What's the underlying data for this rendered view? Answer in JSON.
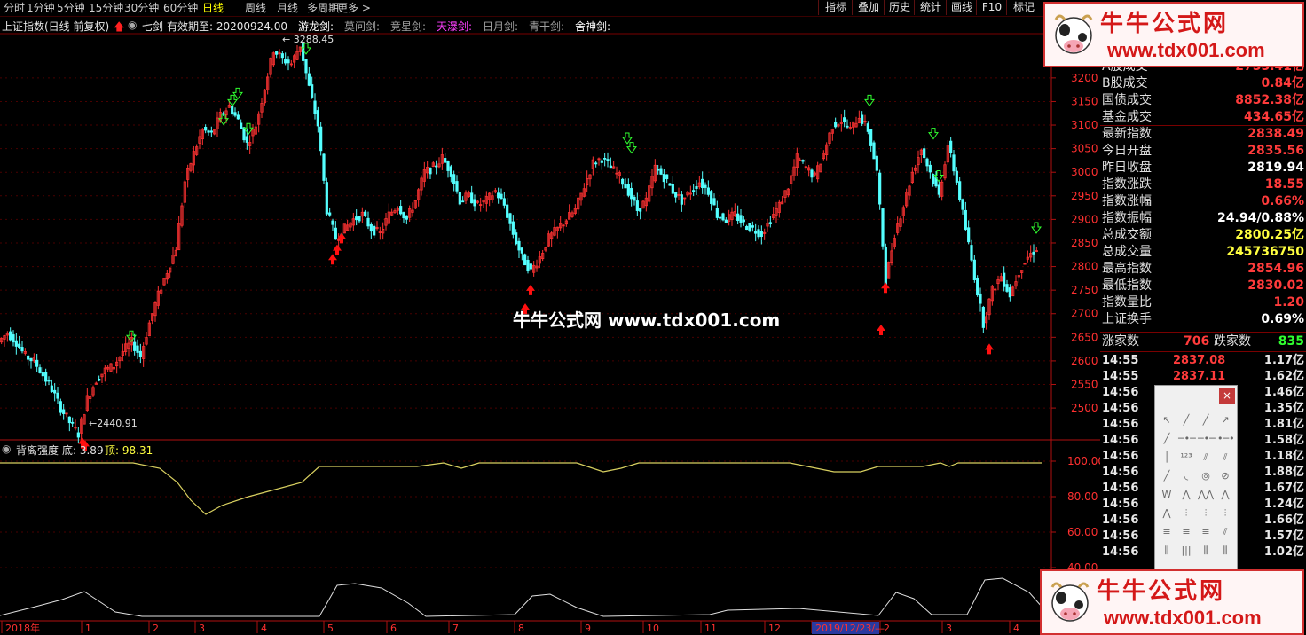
{
  "topbar": {
    "periods": [
      "分时",
      "1分钟",
      "5分钟",
      "15分钟",
      "30分钟",
      "60分钟",
      "日线",
      "周线",
      "月线",
      "多周期",
      "更多"
    ],
    "active_period": "日线",
    "right_buttons": [
      "指标",
      "叠加",
      "历史",
      "统计",
      "画线",
      "F10",
      "标记"
    ]
  },
  "title": {
    "index_name": "上证指数(日线 前复权)",
    "indicator": "七剑",
    "validity": "有效期至: 20200924.00",
    "swords": [
      {
        "label": "游龙剑: -",
        "color": "#ffffff"
      },
      {
        "label": "莫问剑: -",
        "color": "#a0a0a0"
      },
      {
        "label": "竞星剑: -",
        "color": "#a0a0a0"
      },
      {
        "label": "天瀑剑: -",
        "color": "#ff40ff"
      },
      {
        "label": "日月剑: -",
        "color": "#a0a0a0"
      },
      {
        "label": "青干剑: -",
        "color": "#a0a0a0"
      },
      {
        "label": "舍神剑: -",
        "color": "#ffffff"
      }
    ]
  },
  "chart_data": [
    {
      "type": "candlestick",
      "title": "上证指数(日线 前复权)",
      "y_ticks": [
        2500,
        2550,
        2600,
        2650,
        2700,
        2750,
        2800,
        2850,
        2900,
        2950,
        3000,
        3050,
        3100,
        3150,
        3200
      ],
      "ylim": [
        2440,
        3290
      ],
      "annotations": [
        {
          "label": "3288.45",
          "type": "high"
        },
        {
          "label": "2440.91",
          "type": "low"
        }
      ],
      "x_labels": [
        "2018年",
        "1",
        "2",
        "3",
        "4",
        "5",
        "6",
        "7",
        "8",
        "9",
        "10",
        "11",
        "12",
        "2019/12/23/—",
        "2",
        "3",
        "4"
      ],
      "close_path_points": [
        [
          0,
          2640
        ],
        [
          10,
          2660
        ],
        [
          20,
          2640
        ],
        [
          30,
          2610
        ],
        [
          40,
          2600
        ],
        [
          50,
          2570
        ],
        [
          60,
          2540
        ],
        [
          70,
          2500
        ],
        [
          80,
          2470
        ],
        [
          90,
          2445
        ],
        [
          100,
          2520
        ],
        [
          110,
          2560
        ],
        [
          120,
          2580
        ],
        [
          130,
          2590
        ],
        [
          140,
          2620
        ],
        [
          150,
          2640
        ],
        [
          160,
          2610
        ],
        [
          170,
          2680
        ],
        [
          180,
          2740
        ],
        [
          190,
          2790
        ],
        [
          200,
          2840
        ],
        [
          210,
          2980
        ],
        [
          220,
          3040
        ],
        [
          230,
          3090
        ],
        [
          240,
          3080
        ],
        [
          250,
          3120
        ],
        [
          260,
          3140
        ],
        [
          270,
          3110
        ],
        [
          280,
          3060
        ],
        [
          290,
          3100
        ],
        [
          300,
          3180
        ],
        [
          310,
          3260
        ],
        [
          320,
          3240
        ],
        [
          330,
          3230
        ],
        [
          340,
          3270
        ],
        [
          350,
          3180
        ],
        [
          360,
          3100
        ],
        [
          370,
          2920
        ],
        [
          380,
          2860
        ],
        [
          390,
          2880
        ],
        [
          400,
          2900
        ],
        [
          410,
          2910
        ],
        [
          420,
          2880
        ],
        [
          430,
          2870
        ],
        [
          440,
          2910
        ],
        [
          450,
          2930
        ],
        [
          460,
          2900
        ],
        [
          470,
          2940
        ],
        [
          480,
          3000
        ],
        [
          490,
          3010
        ],
        [
          500,
          3030
        ],
        [
          510,
          3000
        ],
        [
          520,
          2940
        ],
        [
          530,
          2950
        ],
        [
          540,
          2930
        ],
        [
          550,
          2940
        ],
        [
          560,
          2960
        ],
        [
          570,
          2930
        ],
        [
          580,
          2870
        ],
        [
          590,
          2820
        ],
        [
          600,
          2790
        ],
        [
          610,
          2820
        ],
        [
          620,
          2860
        ],
        [
          630,
          2880
        ],
        [
          640,
          2900
        ],
        [
          650,
          2920
        ],
        [
          660,
          2970
        ],
        [
          670,
          3020
        ],
        [
          680,
          3030
        ],
        [
          690,
          3010
        ],
        [
          700,
          2990
        ],
        [
          710,
          2960
        ],
        [
          720,
          2920
        ],
        [
          730,
          2940
        ],
        [
          740,
          3010
        ],
        [
          750,
          2990
        ],
        [
          760,
          2960
        ],
        [
          770,
          2940
        ],
        [
          780,
          2960
        ],
        [
          790,
          2980
        ],
        [
          800,
          2960
        ],
        [
          810,
          2910
        ],
        [
          820,
          2900
        ],
        [
          830,
          2910
        ],
        [
          840,
          2890
        ],
        [
          850,
          2880
        ],
        [
          860,
          2870
        ],
        [
          870,
          2900
        ],
        [
          880,
          2930
        ],
        [
          890,
          2970
        ],
        [
          900,
          3030
        ],
        [
          910,
          3010
        ],
        [
          920,
          2990
        ],
        [
          930,
          3040
        ],
        [
          940,
          3100
        ],
        [
          950,
          3110
        ],
        [
          960,
          3090
        ],
        [
          970,
          3120
        ],
        [
          980,
          3090
        ],
        [
          990,
          3000
        ],
        [
          1000,
          2770
        ],
        [
          1010,
          2870
        ],
        [
          1020,
          2930
        ],
        [
          1030,
          3000
        ],
        [
          1040,
          3050
        ],
        [
          1050,
          3000
        ],
        [
          1060,
          2950
        ],
        [
          1070,
          3060
        ],
        [
          1080,
          2980
        ],
        [
          1090,
          2880
        ],
        [
          1100,
          2780
        ],
        [
          1110,
          2680
        ],
        [
          1120,
          2750
        ],
        [
          1130,
          2780
        ],
        [
          1140,
          2740
        ],
        [
          1150,
          2790
        ],
        [
          1160,
          2820
        ],
        [
          1170,
          2840
        ]
      ],
      "signals": {
        "sell": [
          [
            148,
            2620
          ],
          [
            262,
            3120
          ],
          [
            268,
            3135
          ],
          [
            252,
            3080
          ],
          [
            280,
            3060
          ],
          [
            345,
            3230
          ],
          [
            707,
            3040
          ],
          [
            712,
            3020
          ],
          [
            980,
            3120
          ],
          [
            1052,
            3050
          ],
          [
            1058,
            2960
          ],
          [
            1168,
            2850
          ]
        ],
        "buy": [
          [
            93,
            2450
          ],
          [
            96,
            2445
          ],
          [
            375,
            2840
          ],
          [
            380,
            2860
          ],
          [
            385,
            2885
          ],
          [
            592,
            2735
          ],
          [
            598,
            2775
          ],
          [
            993,
            2690
          ],
          [
            998,
            2780
          ],
          [
            1115,
            2650
          ]
        ]
      }
    },
    {
      "type": "line",
      "title": "背离强度",
      "series_labels": [
        {
          "label": "底: 3.89",
          "color": "#e0e0e0"
        },
        {
          "label": "顶: 98.31",
          "color": "#ffff40"
        }
      ],
      "y_ticks": [
        40.0,
        60.0,
        80.0,
        100.0
      ],
      "ylim": [
        30,
        105
      ]
    }
  ],
  "watermark": "牛牛公式网 www.tdx001.com",
  "logo": {
    "title": "牛牛公式网",
    "url": "www.tdx001.com"
  },
  "panel": {
    "rows": [
      {
        "label": "A股成交",
        "value": "2755.41亿",
        "color": "#ff3b3b"
      },
      {
        "label": "B股成交",
        "value": "0.84亿",
        "color": "#ff3b3b"
      },
      {
        "label": "国债成交",
        "value": "8852.38亿",
        "color": "#ff3b3b"
      },
      {
        "label": "基金成交",
        "value": "434.65亿",
        "color": "#ff3b3b"
      },
      {
        "label": "最新指数",
        "value": "2838.49",
        "color": "#ff3b3b"
      },
      {
        "label": "今日开盘",
        "value": "2835.56",
        "color": "#ff3b3b"
      },
      {
        "label": "昨日收盘",
        "value": "2819.94",
        "color": "#ffffff"
      },
      {
        "label": "指数涨跌",
        "value": "18.55",
        "color": "#ff3b3b"
      },
      {
        "label": "指数涨幅",
        "value": "0.66%",
        "color": "#ff3b3b"
      },
      {
        "label": "指数振幅",
        "value": "24.94/0.88%",
        "color": "#ffffff"
      },
      {
        "label": "总成交额",
        "value": "2800.25亿",
        "color": "#ffff40"
      },
      {
        "label": "总成交量",
        "value": "245736750",
        "color": "#ffff40"
      },
      {
        "label": "最高指数",
        "value": "2854.96",
        "color": "#ff3b3b"
      },
      {
        "label": "最低指数",
        "value": "2830.02",
        "color": "#ff3b3b"
      },
      {
        "label": "指数量比",
        "value": "1.20",
        "color": "#ff3b3b"
      },
      {
        "label": "上证换手",
        "value": "0.69%",
        "color": "#ffffff"
      }
    ],
    "updown": {
      "up_label": "涨家数",
      "up": "706",
      "down_label": "跌家数",
      "down": "835"
    },
    "ticks": [
      {
        "t": "14:55",
        "p": "2837.08",
        "v": "1.17亿"
      },
      {
        "t": "14:55",
        "p": "2837.11",
        "v": "1.62亿"
      },
      {
        "t": "14:56",
        "p": "",
        "v": "1.46亿"
      },
      {
        "t": "14:56",
        "p": "",
        "v": "1.35亿"
      },
      {
        "t": "14:56",
        "p": "",
        "v": "1.81亿"
      },
      {
        "t": "14:56",
        "p": "",
        "v": "1.58亿"
      },
      {
        "t": "14:56",
        "p": "",
        "v": "1.18亿"
      },
      {
        "t": "14:56",
        "p": "",
        "v": "1.88亿"
      },
      {
        "t": "14:56",
        "p": "",
        "v": "1.67亿"
      },
      {
        "t": "14:56",
        "p": "",
        "v": "1.24亿"
      },
      {
        "t": "14:56",
        "p": "",
        "v": "1.66亿"
      },
      {
        "t": "14:56",
        "p": "",
        "v": "1.57亿"
      },
      {
        "t": "14:56",
        "p": "",
        "v": "1.02亿"
      }
    ]
  },
  "toolbox": {
    "close_label": "×"
  }
}
